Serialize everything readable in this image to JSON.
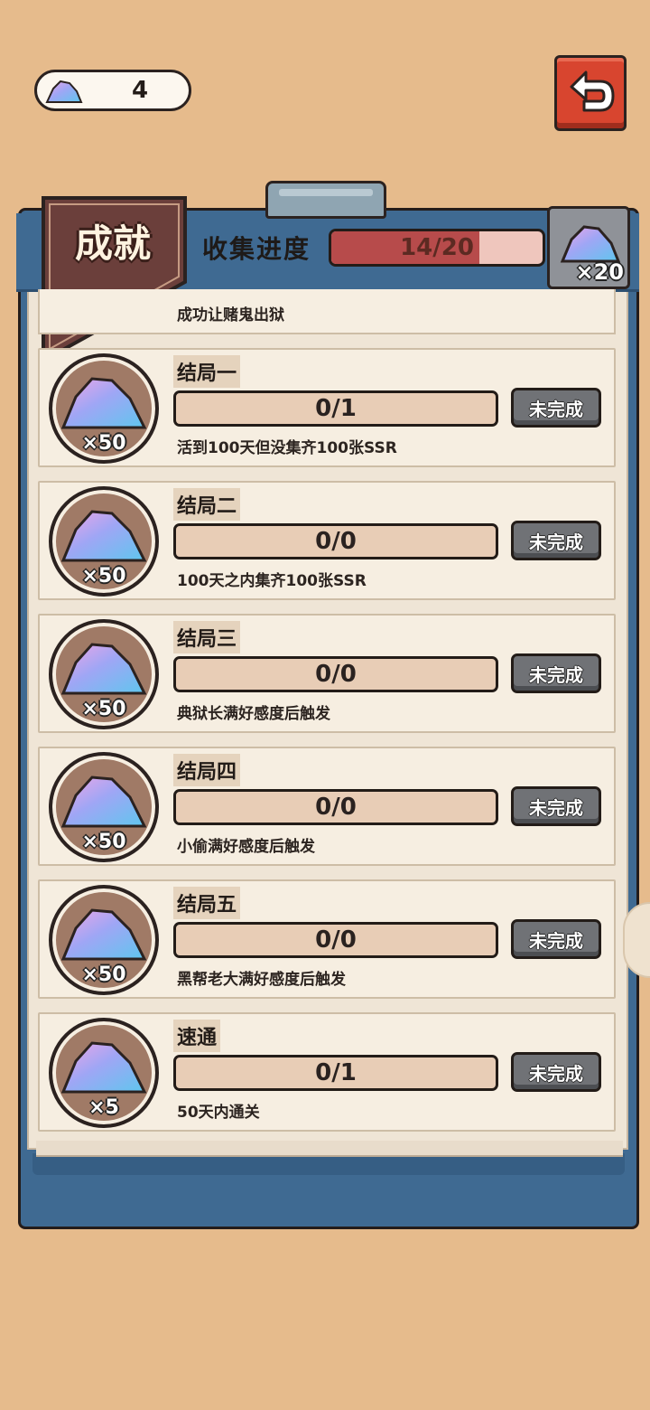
{
  "currency": {
    "icon": "crystal-gem-icon",
    "value": "4"
  },
  "back_button": {
    "icon": "return-arrow-icon",
    "color": "#d8452f"
  },
  "panel": {
    "title": "成就",
    "progress_label": "收集进度",
    "progress_text": "14/20",
    "progress_fraction": 0.7,
    "reward_count": "×20"
  },
  "partial_item": {
    "desc": "成功让赌鬼出狱"
  },
  "achievements": [
    {
      "title": "结局一",
      "progress": "0/1",
      "button": "未完成",
      "desc": "活到100天但没集齐100张SSR",
      "reward": "×50"
    },
    {
      "title": "结局二",
      "progress": "0/0",
      "button": "未完成",
      "desc": "100天之内集齐100张SSR",
      "reward": "×50"
    },
    {
      "title": "结局三",
      "progress": "0/0",
      "button": "未完成",
      "desc": "典狱长满好感度后触发",
      "reward": "×50"
    },
    {
      "title": "结局四",
      "progress": "0/0",
      "button": "未完成",
      "desc": "小偷满好感度后触发",
      "reward": "×50"
    },
    {
      "title": "结局五",
      "progress": "0/0",
      "button": "未完成",
      "desc": "黑帮老大满好感度后触发",
      "reward": "×50"
    },
    {
      "title": "速通",
      "progress": "0/1",
      "button": "未完成",
      "desc": "50天内通关",
      "reward": "×5"
    }
  ],
  "colors": {
    "background": "#e6bb8c",
    "board": "#3f6a92",
    "paper": "#efe5d6",
    "accent": "#b74b4b"
  }
}
